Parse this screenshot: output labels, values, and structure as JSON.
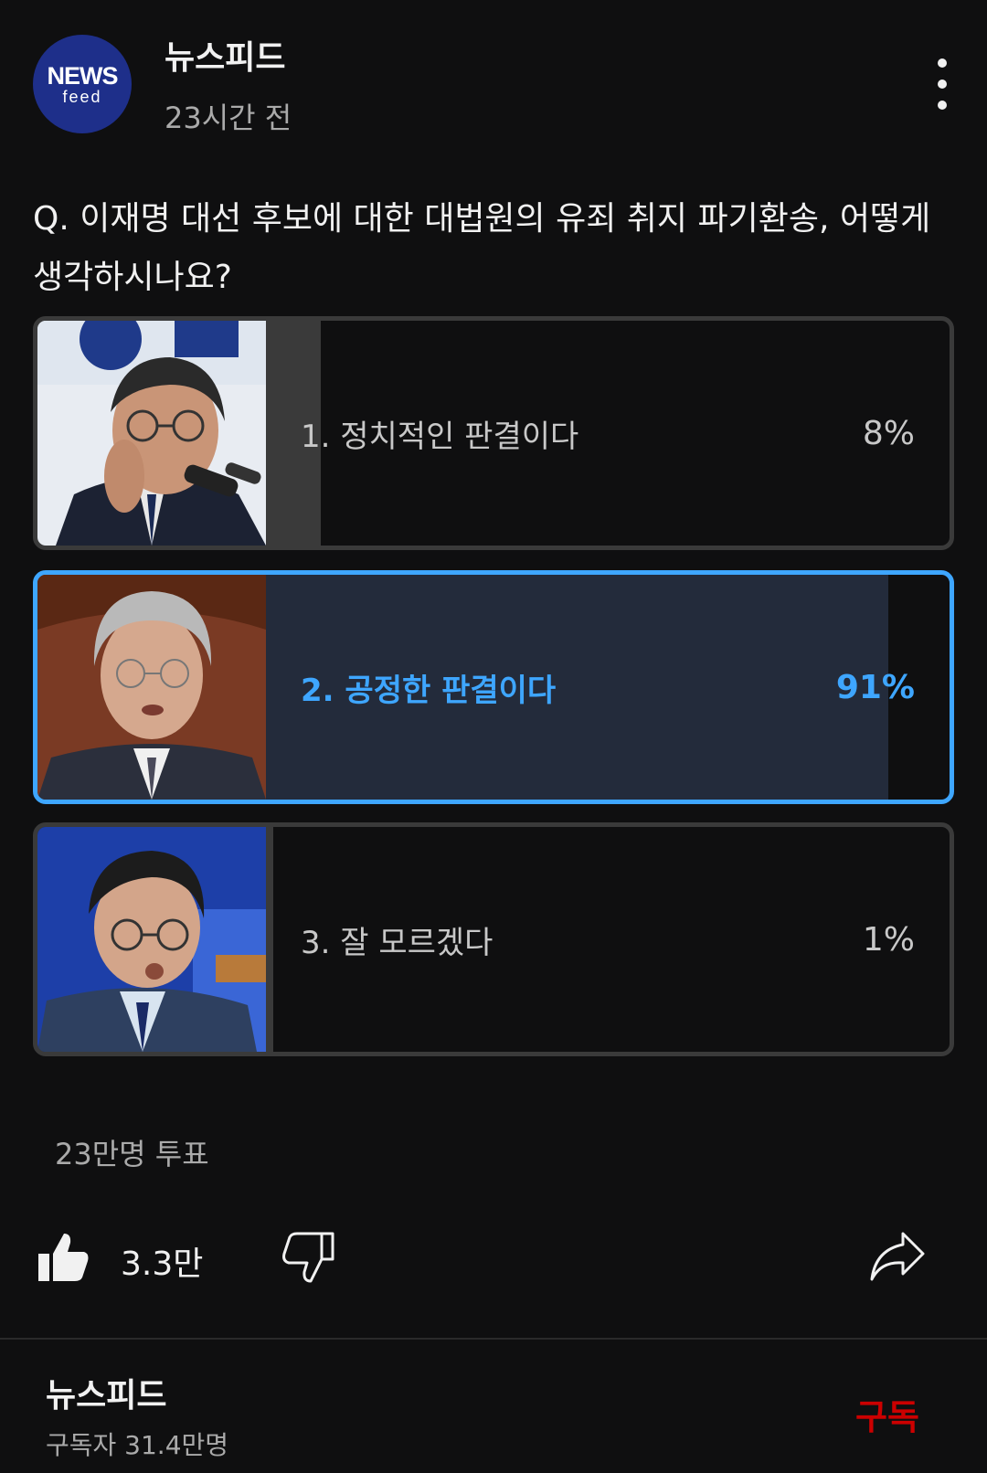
{
  "header": {
    "logo_line1": "NEWS",
    "logo_line2": "feed",
    "channel_name": "뉴스피드",
    "time": "23시간 전",
    "more_icon": "more-vert-icon"
  },
  "question": "Q. 이재명 대선 후보에 대한 대법원의 유죄 취지 파기환송, 어떻게 생각하시나요?",
  "options": [
    {
      "label": "1. 정치적인 판결이다",
      "percent": "8%",
      "fraction": 0.08,
      "selected": false
    },
    {
      "label": "2. 공정한 판결이다",
      "percent": "91%",
      "fraction": 0.91,
      "selected": true
    },
    {
      "label": "3. 잘 모르겠다",
      "percent": "1%",
      "fraction": 0.01,
      "selected": false
    }
  ],
  "votes": "23만명 투표",
  "actions": {
    "like_icon": "thumbs-up-icon",
    "like_count": "3.3만",
    "dislike_icon": "thumbs-down-icon",
    "share_icon": "share-icon"
  },
  "footer": {
    "channel_name": "뉴스피드",
    "subscribers": "구독자 31.4만명",
    "subscribe_label": "구독"
  },
  "colors": {
    "background": "#0f0f10",
    "accent": "#3ea6ff",
    "subscribe": "#cc0000",
    "logo_bg": "#1e2f8a"
  }
}
